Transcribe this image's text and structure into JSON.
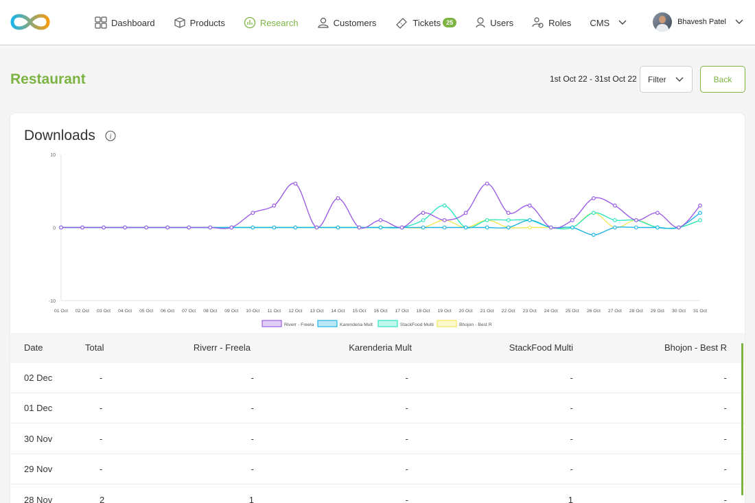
{
  "nav": {
    "items": [
      {
        "label": "Dashboard",
        "icon": "grid-icon"
      },
      {
        "label": "Products",
        "icon": "box-icon"
      },
      {
        "label": "Research",
        "icon": "chart-icon",
        "active": true
      },
      {
        "label": "Customers",
        "icon": "person-icon"
      },
      {
        "label": "Tickets",
        "icon": "ticket-icon",
        "badge": "25"
      },
      {
        "label": "Users",
        "icon": "user-icon"
      },
      {
        "label": "Roles",
        "icon": "roles-icon"
      },
      {
        "label": "CMS",
        "icon": "chevron-down-icon"
      }
    ],
    "user_name": "Bhavesh Patel",
    "accent": "#7cb342"
  },
  "page": {
    "title": "Restaurant",
    "date_range": "1st Oct 22 - 31st Oct 22",
    "filter_label": "Filter",
    "back_label": "Back"
  },
  "card": {
    "title": "Downloads"
  },
  "chart_data": {
    "type": "line",
    "title": "Downloads",
    "ylim": [
      -10,
      10
    ],
    "y_ticks": [
      "10",
      "0",
      "-10"
    ],
    "categories": [
      "01 Oct",
      "02 Oct",
      "03 Oct",
      "04 Oct",
      "05 Oct",
      "06 Oct",
      "07 Oct",
      "08 Oct",
      "09 Oct",
      "10 Oct",
      "11 Oct",
      "12 Oct",
      "13 Oct",
      "14 Oct",
      "15 Oct",
      "16 Oct",
      "17 Oct",
      "18 Oct",
      "19 Oct",
      "20 Oct",
      "21 Oct",
      "22 Oct",
      "23 Oct",
      "24 Oct",
      "25 Oct",
      "26 Oct",
      "27 Oct",
      "28 Oct",
      "29 Oct",
      "30 Oct",
      "31 Oct"
    ],
    "series": [
      {
        "name": "Riverr - Freela",
        "color": "#9b5de5",
        "values": [
          0,
          0,
          0,
          0,
          0,
          0,
          0,
          0,
          0,
          2,
          3,
          6,
          0,
          4,
          0,
          1,
          0,
          2,
          1,
          2,
          6,
          2,
          3,
          0,
          1,
          4,
          3,
          1,
          2,
          0,
          3
        ]
      },
      {
        "name": "Karenderia Mult",
        "color": "#1fb4e6",
        "values": [
          0,
          0,
          0,
          0,
          0,
          0,
          0,
          0,
          0,
          0,
          0,
          0,
          0,
          0,
          0,
          0,
          0,
          0,
          0,
          0,
          0,
          0,
          1,
          0,
          0,
          -1,
          0,
          0,
          0,
          0,
          2
        ]
      },
      {
        "name": "StackFood Multi",
        "color": "#2ee6c0",
        "values": [
          0,
          0,
          0,
          0,
          0,
          0,
          0,
          0,
          0,
          0,
          0,
          0,
          0,
          0,
          0,
          0,
          0,
          1,
          3,
          0,
          1,
          1,
          1,
          0,
          0,
          2,
          1,
          1,
          0,
          0,
          1
        ]
      },
      {
        "name": "Bhojon - Best R",
        "color": "#f2e85c",
        "values": [
          0,
          0,
          0,
          0,
          0,
          0,
          0,
          0,
          0,
          0,
          0,
          0,
          0,
          0,
          0,
          0,
          0,
          0,
          1,
          0,
          1,
          0,
          0,
          0,
          0,
          2,
          0,
          1,
          0,
          0,
          1
        ]
      }
    ],
    "legend": "bottom",
    "grid": false
  },
  "table": {
    "columns": [
      "Date",
      "Total",
      "Riverr - Freela",
      "Karenderia Mult",
      "StackFood Multi",
      "Bhojon - Best R"
    ],
    "rows": [
      [
        "02 Dec",
        "-",
        "-",
        "-",
        "-",
        "-"
      ],
      [
        "01 Dec",
        "-",
        "-",
        "-",
        "-",
        "-"
      ],
      [
        "30 Nov",
        "-",
        "-",
        "-",
        "-",
        "-"
      ],
      [
        "29 Nov",
        "-",
        "-",
        "-",
        "-",
        "-"
      ],
      [
        "28 Nov",
        "2",
        "1",
        "-",
        "1",
        "-"
      ]
    ]
  }
}
